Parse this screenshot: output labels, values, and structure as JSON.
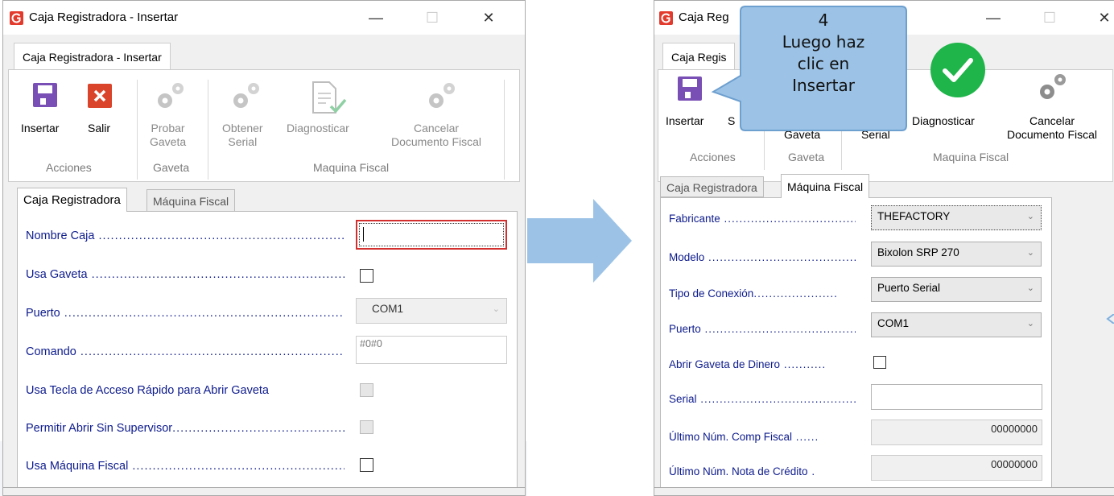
{
  "left_window": {
    "title": "Caja Registradora - Insertar",
    "ribbon_tab": "Caja Registradora - Insertar",
    "ribbon": {
      "insertar": "Insertar",
      "salir": "Salir",
      "probar_line1": "Probar",
      "probar_line2": "Gaveta",
      "obtener_line1": "Obtener",
      "obtener_line2": "Serial",
      "diagnosticar": "Diagnosticar",
      "cancelar_line1": "Cancelar",
      "cancelar_line2": "Documento Fiscal",
      "group_acciones": "Acciones",
      "group_gaveta": "Gaveta",
      "group_maquina": "Maquina Fiscal"
    },
    "tabs": [
      "Caja Registradora",
      "Máquina Fiscal"
    ],
    "fields": {
      "nombre_caja": "Nombre Caja",
      "usa_gaveta": "Usa Gaveta",
      "puerto": "Puerto",
      "puerto_value": "COM1",
      "comando": "Comando",
      "comando_value": "#0#0",
      "usa_tecla": "Usa Tecla de Acceso Rápido para Abrir Gaveta",
      "permitir": "Permitir Abrir Sin Supervisor",
      "usa_maquina": "Usa Máquina Fiscal"
    }
  },
  "right_window": {
    "title": "Caja Reg",
    "ribbon_tab": "Caja Regis",
    "ribbon": {
      "insertar": "Insertar",
      "salir_partial": "S",
      "gaveta": "Gaveta",
      "serial": "Serial",
      "diagnosticar": "Diagnosticar",
      "cancelar_line1": "Cancelar",
      "cancelar_line2": "Documento Fiscal",
      "group_acciones": "Acciones",
      "group_gaveta": "Gaveta",
      "group_maquina": "Maquina Fiscal"
    },
    "tabs": [
      "Caja Registradora",
      "Máquina Fiscal"
    ],
    "fields": {
      "fabricante": "Fabricante",
      "fabricante_value": "THEFACTORY",
      "modelo": "Modelo",
      "modelo_value": "Bixolon SRP 270",
      "tipo_conexion": "Tipo de Conexión",
      "tipo_conexion_value": "Puerto Serial",
      "puerto": "Puerto",
      "puerto_value": "COM1",
      "abrir_gaveta": "Abrir Gaveta de Dinero",
      "serial": "Serial",
      "ultimo_comp": "Último Núm. Comp Fiscal",
      "ultimo_comp_value": "00000000",
      "ultimo_nota": "Último Núm. Nota de Crédito",
      "ultimo_nota_value": "00000000"
    }
  },
  "callout": {
    "step": "4",
    "line1": "Luego haz",
    "line2": "clic en",
    "line3": "Insertar"
  },
  "colors": {
    "save_icon": "#7a4fb5",
    "exit_icon": "#d9442a",
    "callout_fill": "#9cc3e6",
    "check_circle": "#1fb54a",
    "arrow": "#9cc3e6",
    "label_text": "#0d1b8c"
  }
}
